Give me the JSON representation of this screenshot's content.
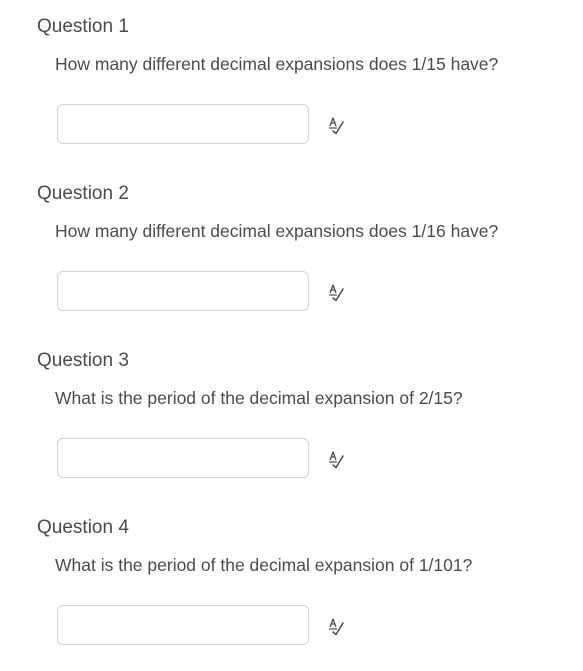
{
  "questions": [
    {
      "title": "Question 1",
      "text": "How many different decimal expansions does 1/15 have?",
      "answer_value": "",
      "icon": "spellcheck-icon"
    },
    {
      "title": "Question 2",
      "text": "How many different decimal expansions does 1/16 have?",
      "answer_value": "",
      "icon": "spellcheck-icon"
    },
    {
      "title": "Question 3",
      "text": "What is the period of the decimal expansion of 2/15?",
      "answer_value": "",
      "icon": "spellcheck-icon"
    },
    {
      "title": "Question 4",
      "text": "What is the period of the decimal expansion of 1/101?",
      "answer_value": "",
      "icon": "spellcheck-icon"
    }
  ],
  "colors": {
    "text": "#494c4e",
    "input_border": "#cdd5dc",
    "background": "#ffffff"
  }
}
